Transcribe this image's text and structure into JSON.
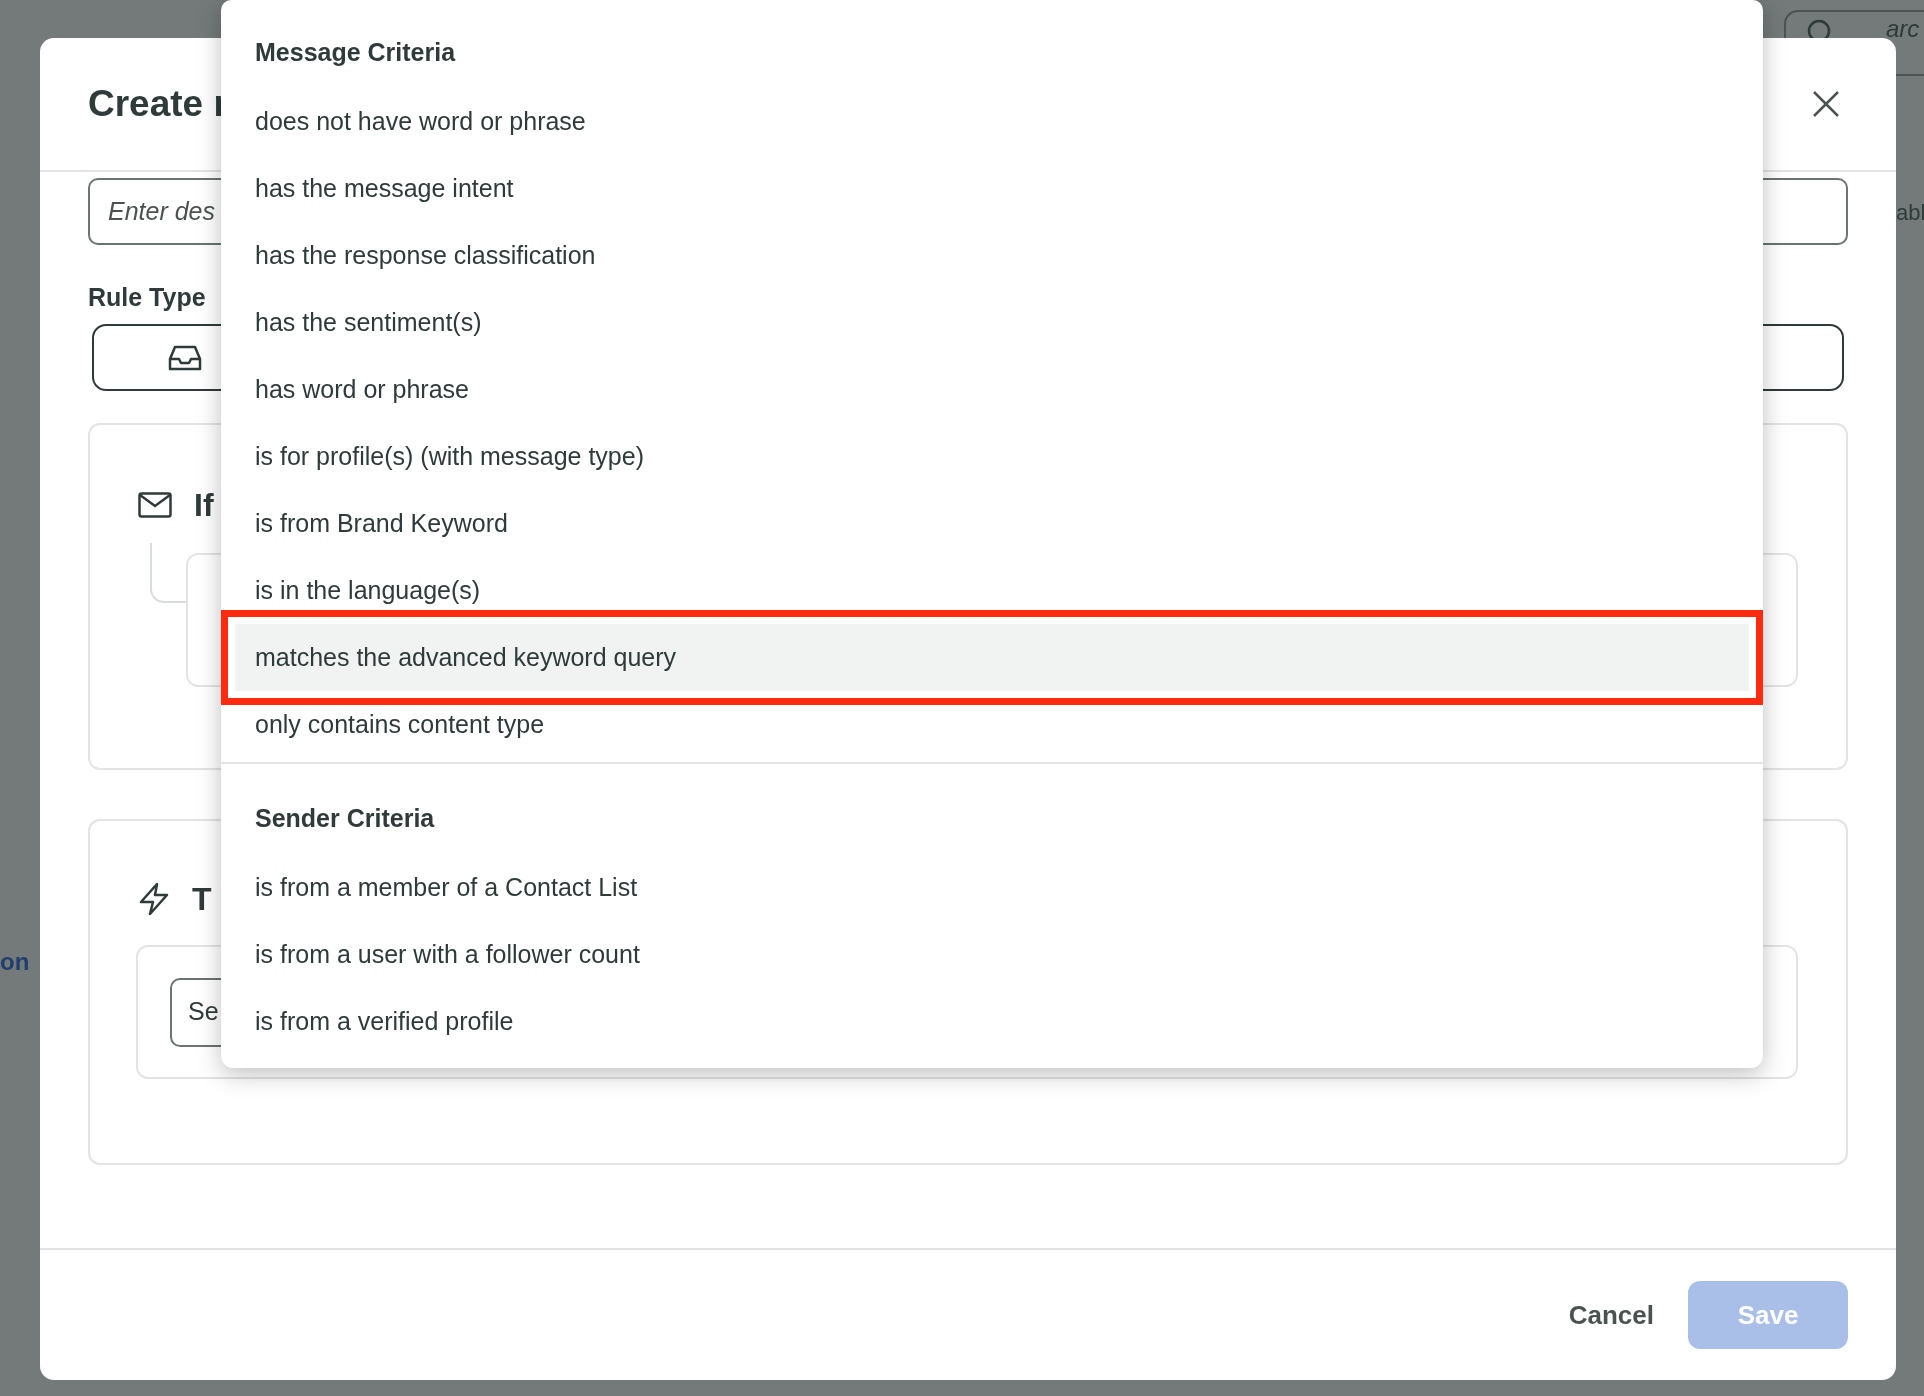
{
  "page": {
    "search_text": "arc",
    "side_text": "abl",
    "nav_link": "on"
  },
  "modal": {
    "title": "Create r",
    "description_placeholder": "Enter des",
    "rule_type_label": "Rule Type",
    "if_label": "If",
    "then_label": "T",
    "select_text": "Se",
    "cancel": "Cancel",
    "save": {
      "label": "Save",
      "disabled": true
    }
  },
  "dropdown": {
    "groups": [
      {
        "heading": "Message Criteria",
        "items": [
          {
            "label": "does not have word or phrase",
            "selected": false
          },
          {
            "label": "has the message intent",
            "selected": false
          },
          {
            "label": "has the response classification",
            "selected": false
          },
          {
            "label": "has the sentiment(s)",
            "selected": false
          },
          {
            "label": "has word or phrase",
            "selected": false
          },
          {
            "label": "is for profile(s) (with message type)",
            "selected": false
          },
          {
            "label": "is from Brand Keyword",
            "selected": false
          },
          {
            "label": "is in the language(s)",
            "selected": false
          },
          {
            "label": "matches the advanced keyword query",
            "selected": true
          },
          {
            "label": "only contains content type",
            "selected": false
          }
        ]
      },
      {
        "heading": "Sender Criteria",
        "items": [
          {
            "label": "is from a member of a Contact List",
            "selected": false
          },
          {
            "label": "is from a user with a follower count",
            "selected": false
          },
          {
            "label": "is from a verified profile",
            "selected": false
          }
        ]
      }
    ]
  }
}
